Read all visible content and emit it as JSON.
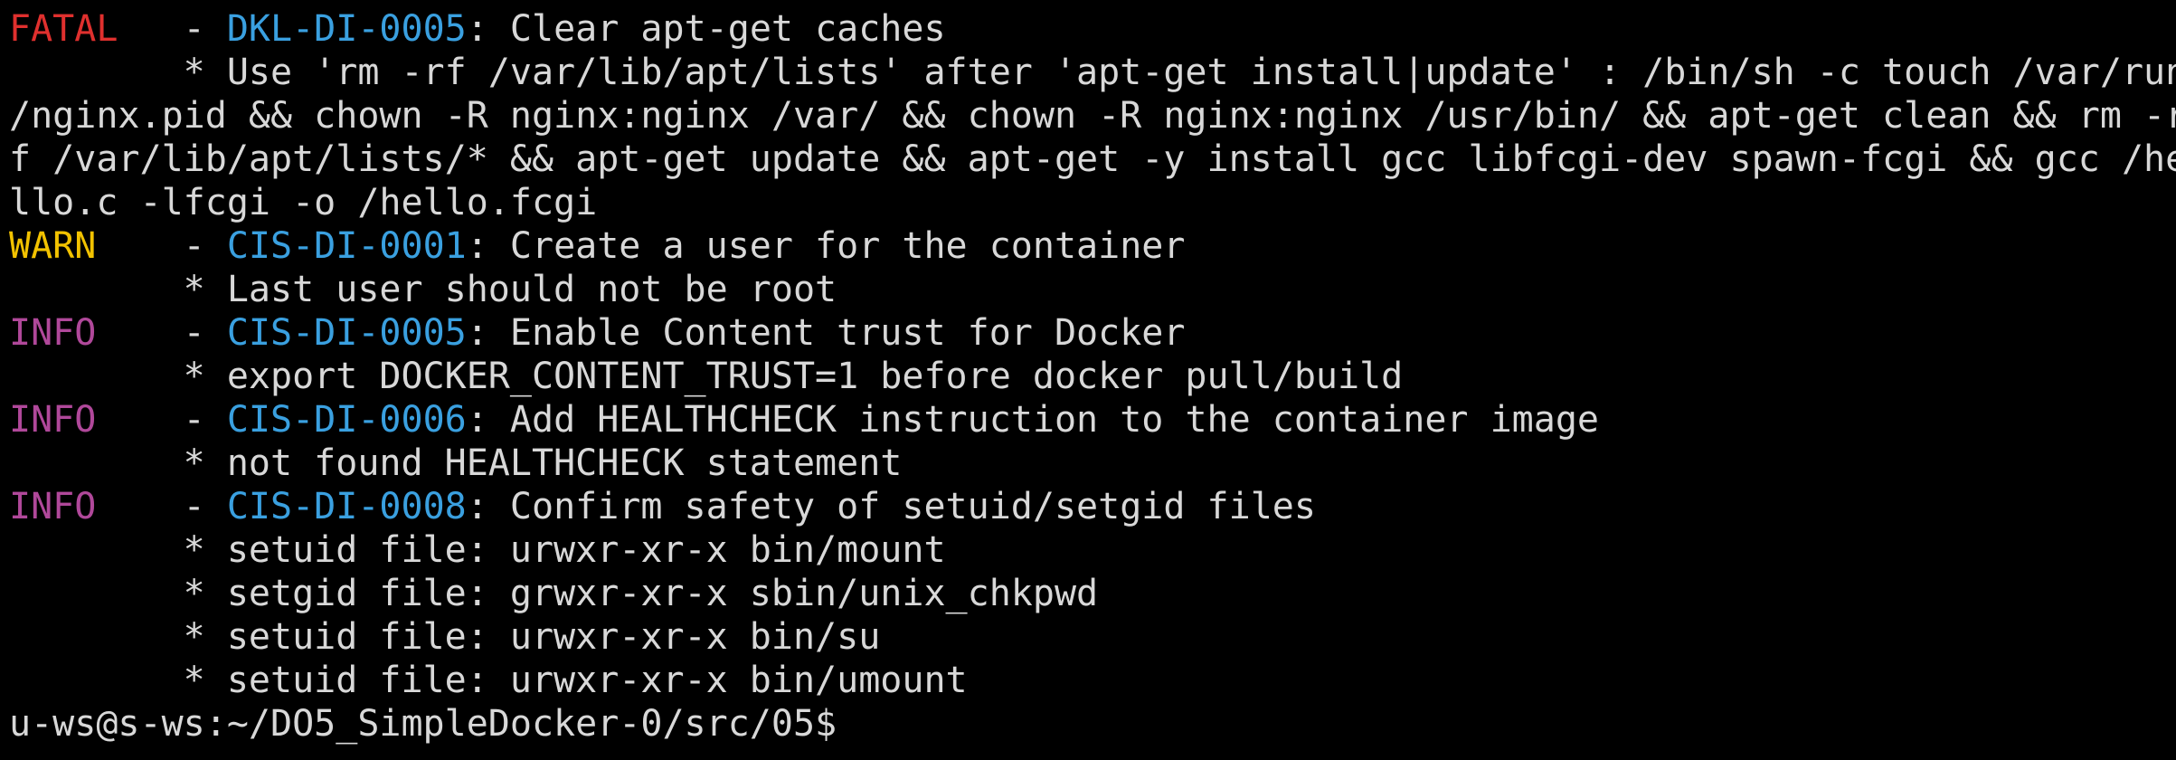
{
  "colors": {
    "background": "#000000",
    "text": "#d8d8d8",
    "fatal": "#e0302e",
    "warn": "#f2c200",
    "info": "#b0489a",
    "code": "#3aa0e0"
  },
  "terminal": {
    "cut_top_line": "                                                                                         ",
    "fatal_check": {
      "level": "FATAL",
      "separator": "   - ",
      "code": "DKL-DI-0005",
      "title": ": Clear apt-get caches",
      "details": [
        "        * Use 'rm -rf /var/lib/apt/lists' after 'apt-get install|update' : /bin/sh -c touch /var/run",
        "/nginx.pid && chown -R nginx:nginx /var/ && chown -R nginx:nginx /usr/bin/ && apt-get clean && rm -r",
        "f /var/lib/apt/lists/* && apt-get update && apt-get -y install gcc libfcgi-dev spawn-fcgi && gcc /he",
        "llo.c -lfcgi -o /hello.fcgi"
      ]
    },
    "warn_check": {
      "level": "WARN",
      "separator": "    - ",
      "code": "CIS-DI-0001",
      "title": ": Create a user for the container",
      "details": [
        "        * Last user should not be root"
      ]
    },
    "info_checks": [
      {
        "level": "INFO",
        "separator": "    - ",
        "code": "CIS-DI-0005",
        "title": ": Enable Content trust for Docker",
        "details": [
          "        * export DOCKER_CONTENT_TRUST=1 before docker pull/build"
        ]
      },
      {
        "level": "INFO",
        "separator": "    - ",
        "code": "CIS-DI-0006",
        "title": ": Add HEALTHCHECK instruction to the container image",
        "details": [
          "        * not found HEALTHCHECK statement"
        ]
      },
      {
        "level": "INFO",
        "separator": "    - ",
        "code": "CIS-DI-0008",
        "title": ": Confirm safety of setuid/setgid files",
        "details": [
          "        * setuid file: urwxr-xr-x bin/mount",
          "        * setgid file: grwxr-xr-x sbin/unix_chkpwd",
          "        * setuid file: urwxr-xr-x bin/su",
          "        * setuid file: urwxr-xr-x bin/umount"
        ]
      }
    ],
    "prompt": "u-ws@s-ws:~/DO5_SimpleDocker-0/src/05$"
  }
}
